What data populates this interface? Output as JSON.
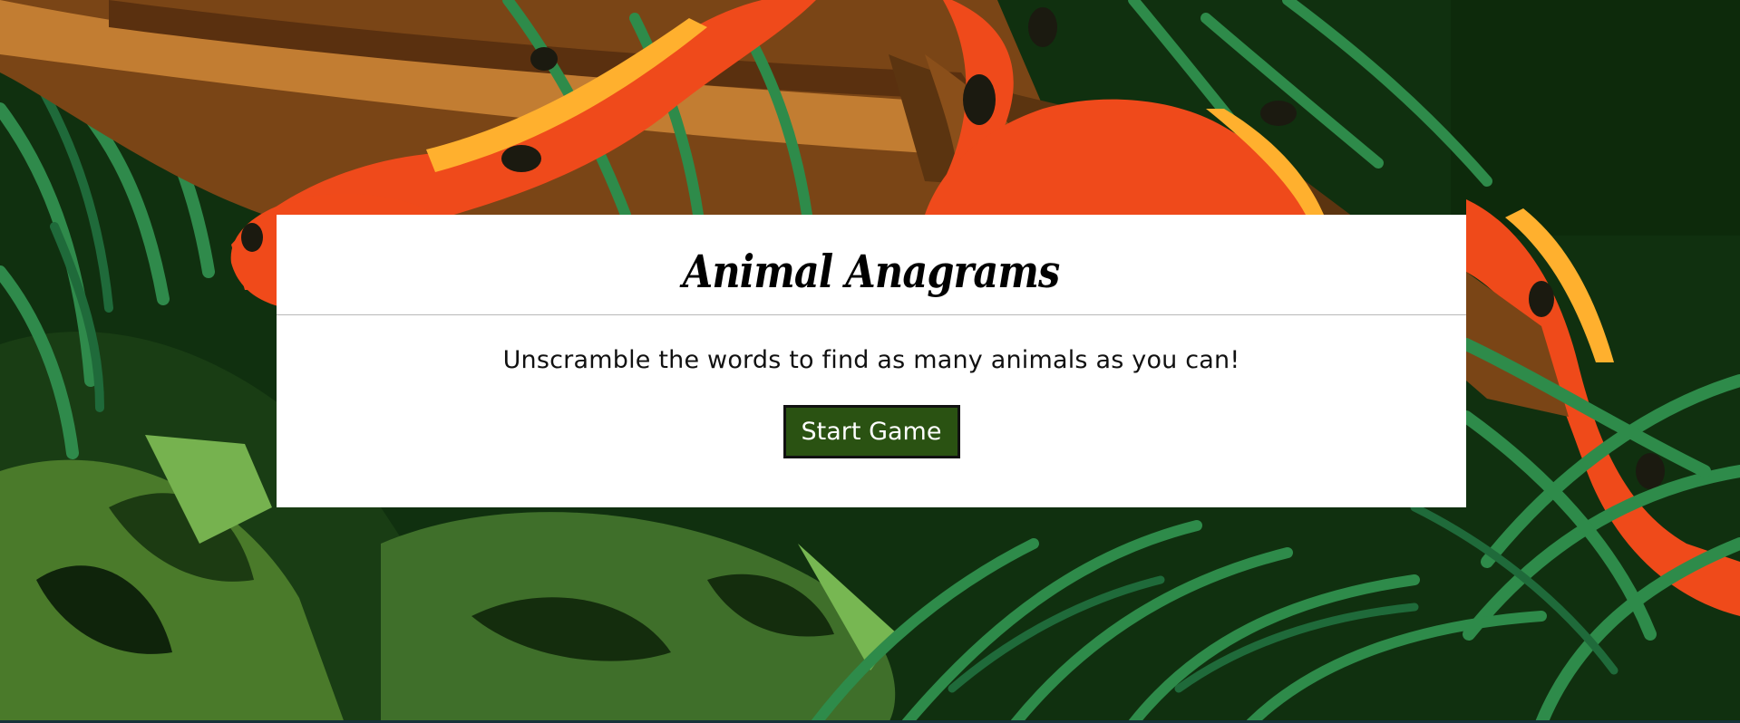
{
  "modal": {
    "title": "Animal Anagrams",
    "description": "Unscramble the words to find as many animals as you can!",
    "start_button_label": "Start Game"
  },
  "background": {
    "scene": "jungle",
    "colors": {
      "dark_leaf": "#0f2a0f",
      "leaf_green": "#2e8b4a",
      "moss_green": "#3f6f2a",
      "snake_orange": "#f04a1a",
      "snake_yellow": "#ffb02e",
      "branch_brown": "#7a4516"
    }
  },
  "theme": {
    "button_bg": "#2a5212",
    "button_text": "#ffffff",
    "modal_bg": "#ffffff"
  }
}
